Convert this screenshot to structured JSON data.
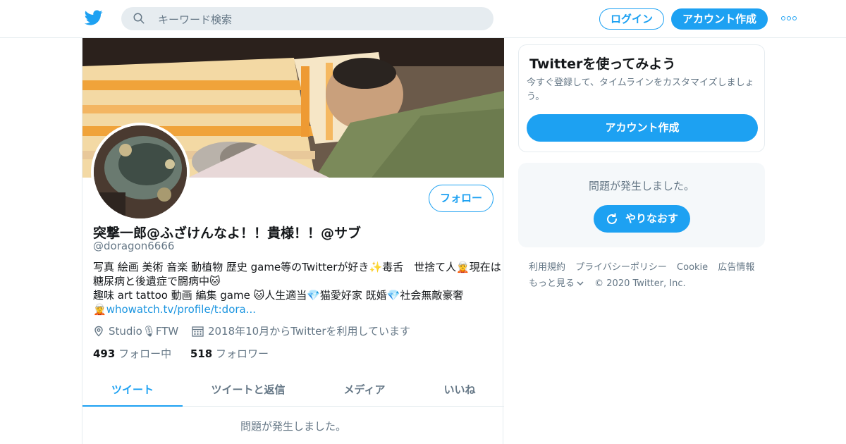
{
  "search": {
    "placeholder": "キーワード検索"
  },
  "header": {
    "login_label": "ログイン",
    "signup_label": "アカウント作成"
  },
  "profile": {
    "name": "突撃一郎@ふざけんなよ！！貴様！！@サブ",
    "handle": "@doragon6666",
    "follow_label": "フォロー",
    "bio_lines": [
      "写真 絵画 美術 音楽 動植物 歴史 game等のTwitterが好き✨毒舌　世捨て人🧝現在は",
      "糖尿病と後遺症で闘病中🐱",
      "趣味 art tattoo 動画 編集 game 🐱人生適当💎猫愛好家 既婚💎社会無敵豪奢",
      "🧝"
    ],
    "bio_link": "whowatch.tv/profile/t:dora...",
    "location": "Studio🎙FTW",
    "joined": "2018年10月からTwitterを利用しています",
    "following_count": "493",
    "following_label": "フォロー中",
    "followers_count": "518",
    "followers_label": "フォロワー"
  },
  "tabs": [
    {
      "label": "ツイート",
      "active": true
    },
    {
      "label": "ツイートと返信",
      "active": false
    },
    {
      "label": "メディア",
      "active": false
    },
    {
      "label": "いいね",
      "active": false
    }
  ],
  "main": {
    "error_message": "問題が発生しました。"
  },
  "sidebar": {
    "card_title": "Twitterを使ってみよう",
    "card_text": "今すぐ登録して、タイムラインをカスタマイズしましょう。",
    "card_button": "アカウント作成",
    "error_message": "問題が発生しました。",
    "retry_label": "やりなおす"
  },
  "footer": {
    "links": [
      "利用規約",
      "プライバシーポリシー",
      "Cookie",
      "広告情報",
      "もっと見る"
    ],
    "copyright": "© 2020 Twitter, Inc."
  },
  "colors": {
    "accent": "#1da1f2",
    "text_secondary": "#657786",
    "border": "#e6ecf0"
  },
  "icons": [
    "twitter-bird-icon",
    "search-icon",
    "more-dots-icon",
    "location-icon",
    "calendar-icon",
    "retry-icon",
    "chevron-down-icon"
  ]
}
